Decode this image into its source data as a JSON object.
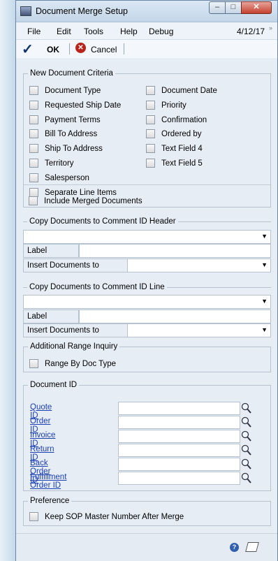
{
  "window": {
    "title": "Document Merge Setup"
  },
  "menu": {
    "items": [
      "File",
      "Edit",
      "Tools",
      "Help",
      "Debug"
    ],
    "date": "4/12/17"
  },
  "toolbar": {
    "ok": "OK",
    "cancel": "Cancel"
  },
  "criteria": {
    "title": "New Document Criteria",
    "left": [
      "Document Type",
      "Requested Ship Date",
      "Payment Terms",
      "Bill To Address",
      "Ship To Address",
      "Territory",
      "Salesperson"
    ],
    "right": [
      "Document Date",
      "Priority",
      "Confirmation",
      "Ordered by",
      "Text Field 4",
      "Text Field 5"
    ],
    "separate": "Separate Line Items",
    "include": "Include Merged Documents"
  },
  "header_group": {
    "title": "Copy Documents to Comment ID Header",
    "label": "Label",
    "insert": "Insert Documents to"
  },
  "line_group": {
    "title": "Copy Documents to Comment ID Line",
    "label": "Label",
    "insert": "Insert Documents to"
  },
  "range": {
    "title": "Additional Range Inquiry",
    "option": "Range By Doc Type"
  },
  "docid": {
    "title": "Document ID",
    "items": [
      "Quote ID",
      "Order ID",
      "Invoice ID",
      "Return ID",
      "Back Order ID",
      "Fulfillment Order ID"
    ]
  },
  "preference": {
    "title": "Preference",
    "option": "Keep SOP Master Number After Merge"
  },
  "icons": [
    "check-icon",
    "cancel-icon",
    "lookup-icon",
    "help-icon",
    "note-icon"
  ]
}
